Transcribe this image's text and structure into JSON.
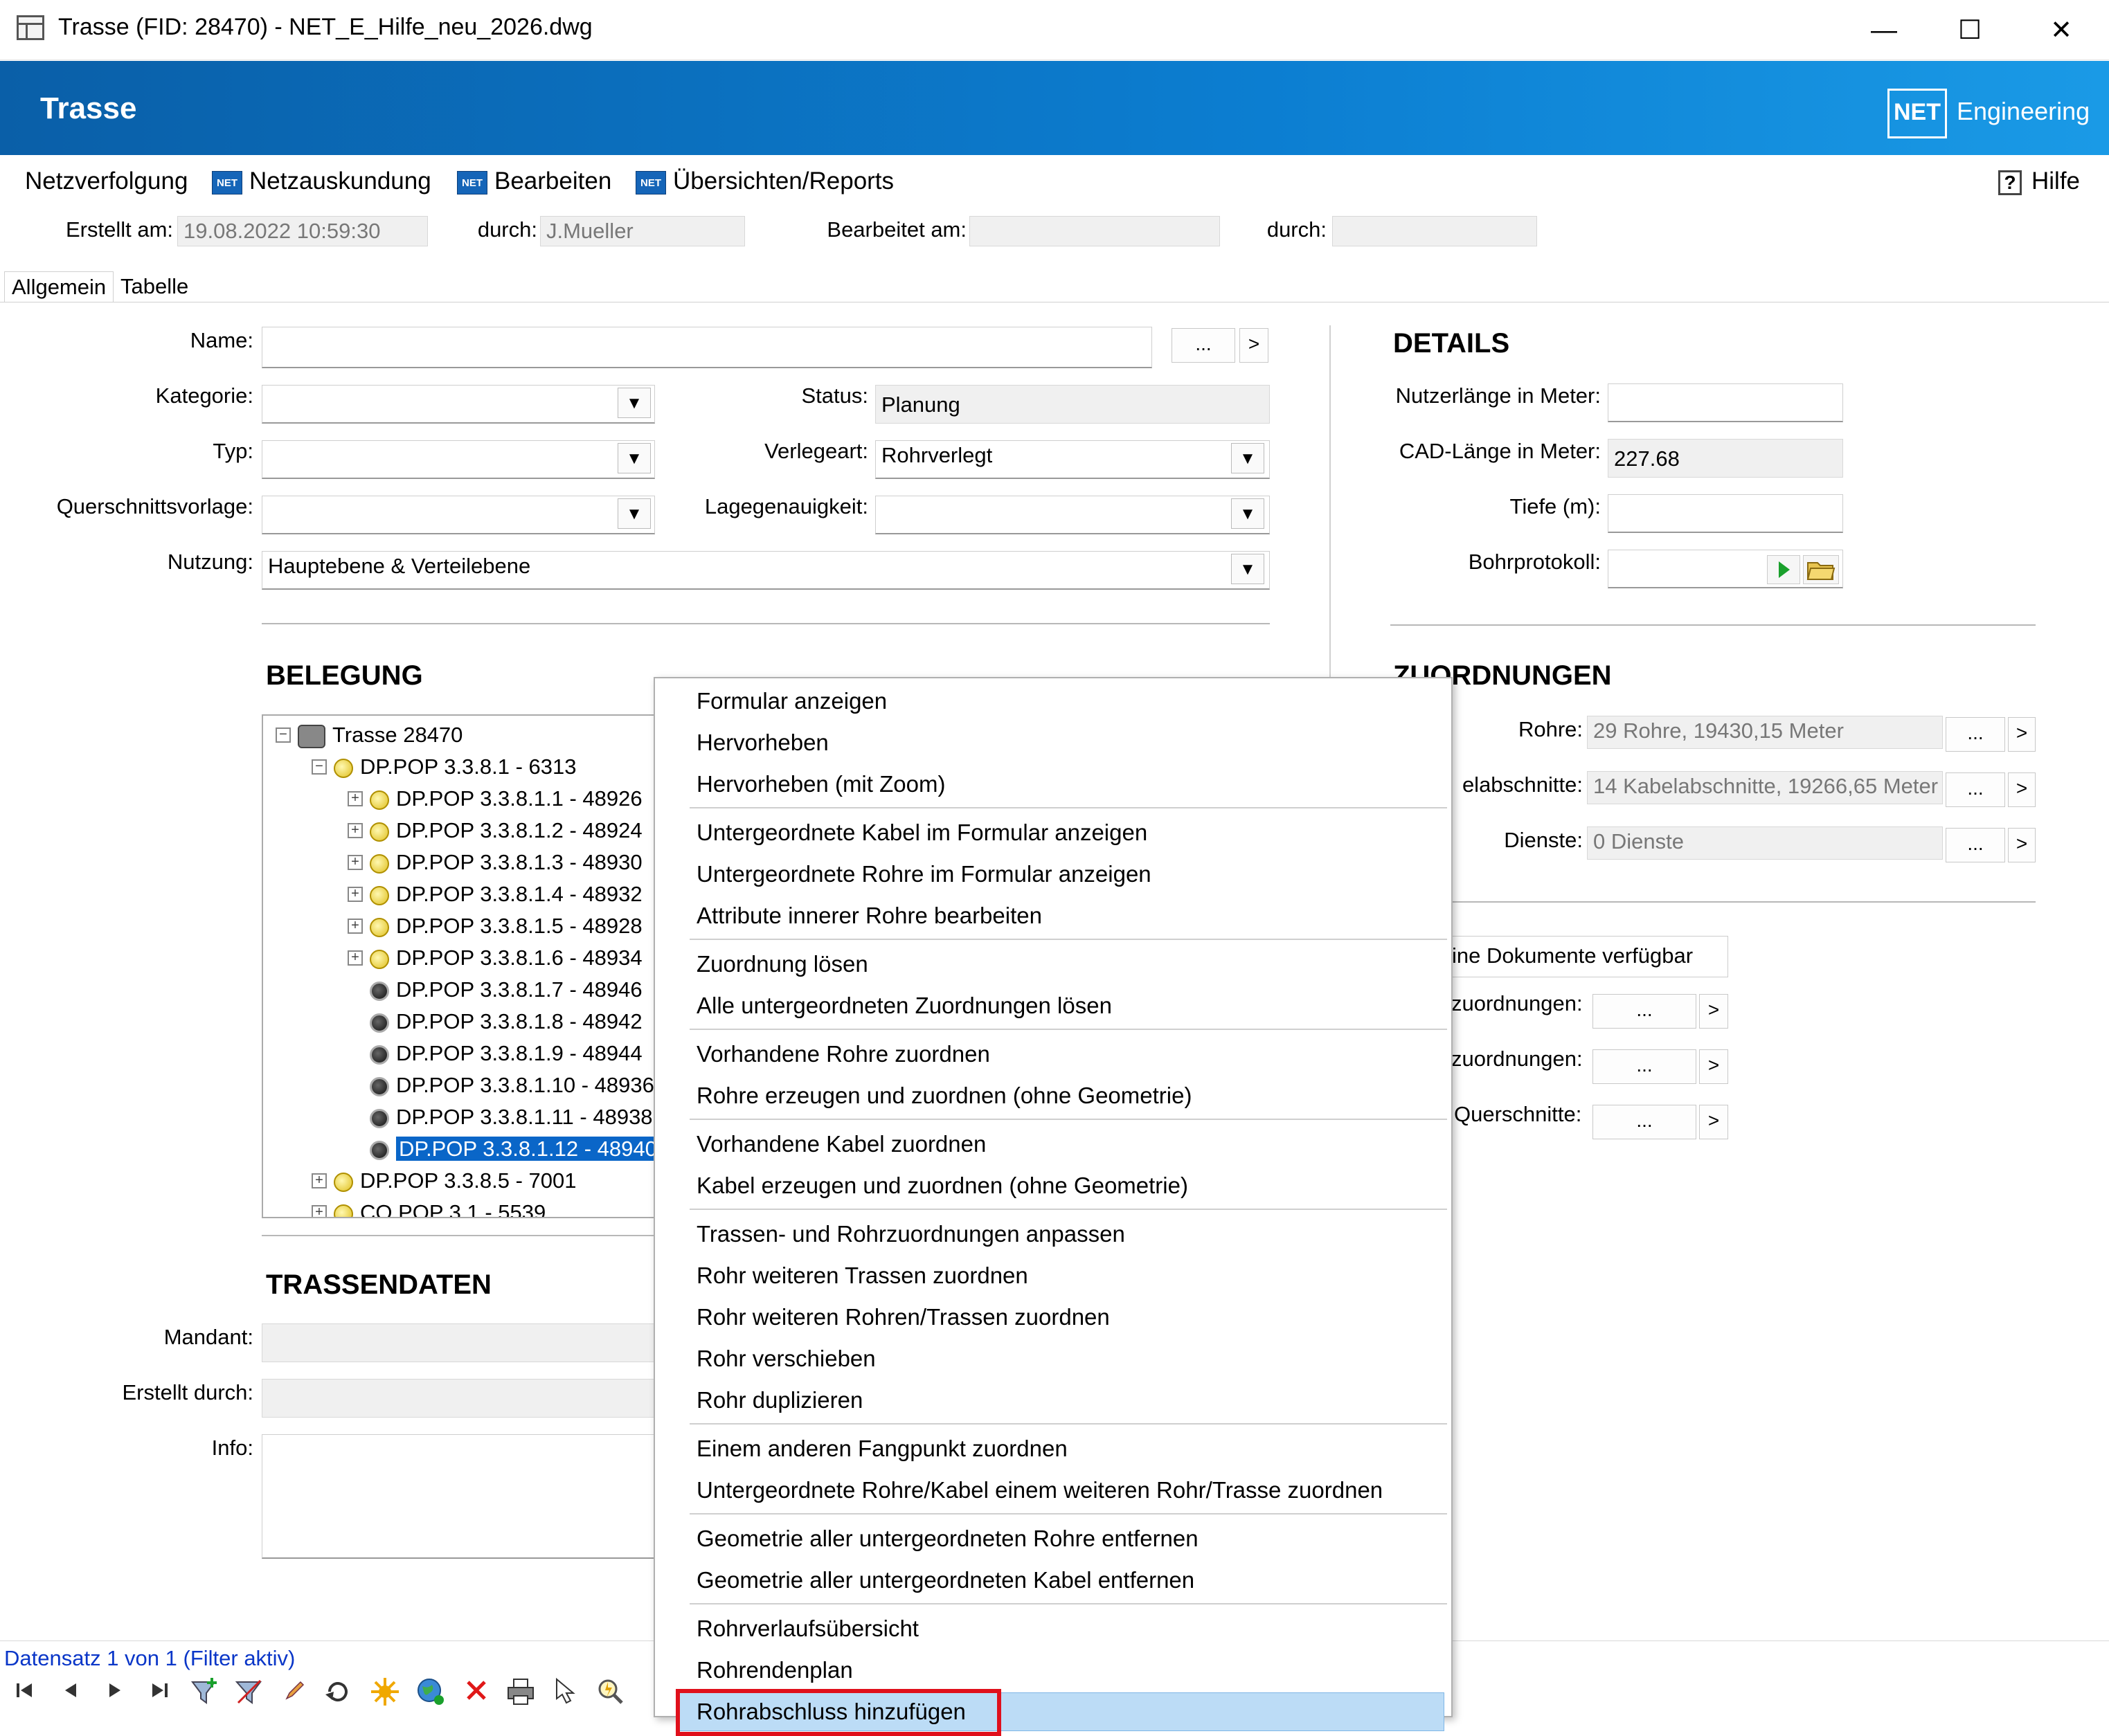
{
  "window": {
    "title": "Trasse (FID: 28470) - NET_E_Hilfe_neu_2026.dwg",
    "minimize": "—",
    "maximize": "☐",
    "close": "✕"
  },
  "banner": {
    "title": "Trasse",
    "logo": "NET",
    "brand": "Engineering"
  },
  "menu": {
    "items": [
      "Netzverfolgung",
      "Netzauskundung",
      "Bearbeiten",
      "Übersichten/Reports"
    ],
    "net_icon_text": "NET",
    "help": "Hilfe"
  },
  "meta": {
    "created_label": "Erstellt am:",
    "created_value": "19.08.2022 10:59:30",
    "by_label": "durch:",
    "by_value": "J.Mueller",
    "edited_label": "Bearbeitet am:",
    "edited_value": "",
    "by2_label": "durch:",
    "by2_value": ""
  },
  "tabs": [
    "Allgemein",
    "Tabelle"
  ],
  "form": {
    "name_label": "Name:",
    "name_value": "",
    "kategorie_label": "Kategorie:",
    "kategorie_value": "",
    "typ_label": "Typ:",
    "typ_value": "",
    "qsv_label": "Querschnittsvorlage:",
    "qsv_value": "",
    "nutzung_label": "Nutzung:",
    "nutzung_value": "Hauptebene & Verteilebene",
    "status_label": "Status:",
    "status_value": "Planung",
    "verlegeart_label": "Verlegeart:",
    "verlegeart_value": "Rohrverlegt",
    "lage_label": "Lagegenauigkeit:",
    "lage_value": "",
    "dots": "...",
    "arrow": ">",
    "dropdown": "▼"
  },
  "details": {
    "heading": "DETAILS",
    "nutzer_label": "Nutzerlänge in Meter:",
    "nutzer_value": "",
    "cad_label": "CAD-Länge in Meter:",
    "cad_value": "227.68",
    "tiefe_label": "Tiefe (m):",
    "tiefe_value": "",
    "bohr_label": "Bohrprotokoll:",
    "bohr_value": ""
  },
  "zuordnungen": {
    "heading": "ZUORDNUNGEN",
    "rohre_label": "Rohre:",
    "rohre_value": "29 Rohre, 19430,15 Meter",
    "kabel_label": "elabschnitte:",
    "kabel_value": "14 Kabelabschnitte, 19266,65 Meter",
    "dienste_label": "Dienste:",
    "dienste_value": "0 Dienste",
    "dokumente": "ine Dokumente verfügbar",
    "z1_label": "zuordnungen:",
    "z2_label": "zuordnungen:",
    "z3_label": "Querschnitte:"
  },
  "belegung": {
    "heading": "BELEGUNG",
    "tree": [
      {
        "label": "Trasse 28470",
        "level": 0,
        "icon": "root",
        "expand": "−"
      },
      {
        "label": "DP.POP 3.3.8.1 - 6313",
        "level": 1,
        "icon": "yellow",
        "expand": "−"
      },
      {
        "label": "DP.POP 3.3.8.1.1 - 48926",
        "level": 2,
        "icon": "yellow",
        "expand": "+"
      },
      {
        "label": "DP.POP 3.3.8.1.2 - 48924",
        "level": 2,
        "icon": "yellow",
        "expand": "+"
      },
      {
        "label": "DP.POP 3.3.8.1.3 - 48930",
        "level": 2,
        "icon": "yellow",
        "expand": "+"
      },
      {
        "label": "DP.POP 3.3.8.1.4 - 48932",
        "level": 2,
        "icon": "yellow",
        "expand": "+"
      },
      {
        "label": "DP.POP 3.3.8.1.5 - 48928",
        "level": 2,
        "icon": "yellow",
        "expand": "+"
      },
      {
        "label": "DP.POP 3.3.8.1.6 - 48934",
        "level": 2,
        "icon": "yellow",
        "expand": "+"
      },
      {
        "label": "DP.POP 3.3.8.1.7 - 48946",
        "level": 2,
        "icon": "black",
        "expand": ""
      },
      {
        "label": "DP.POP 3.3.8.1.8 - 48942",
        "level": 2,
        "icon": "black",
        "expand": ""
      },
      {
        "label": "DP.POP 3.3.8.1.9 - 48944",
        "level": 2,
        "icon": "black",
        "expand": ""
      },
      {
        "label": "DP.POP 3.3.8.1.10 - 48936",
        "level": 2,
        "icon": "black",
        "expand": ""
      },
      {
        "label": "DP.POP 3.3.8.1.11 - 48938",
        "level": 2,
        "icon": "black",
        "expand": ""
      },
      {
        "label": "DP.POP 3.3.8.1.12 - 48940",
        "level": 2,
        "icon": "black",
        "expand": "",
        "selected": true
      },
      {
        "label": "DP.POP 3.3.8.5 - 7001",
        "level": 1,
        "icon": "yellow",
        "expand": "+"
      },
      {
        "label": "CO.POP 3.1 - 5539",
        "level": 1,
        "icon": "yellow",
        "expand": "+"
      }
    ]
  },
  "trassendaten": {
    "heading": "TRASSENDATEN",
    "mandant_label": "Mandant:",
    "erstellt_label": "Erstellt durch:",
    "info_label": "Info:"
  },
  "context_menu": {
    "groups": [
      [
        "Formular anzeigen",
        "Hervorheben",
        "Hervorheben (mit Zoom)"
      ],
      [
        "Untergeordnete Kabel im Formular anzeigen",
        "Untergeordnete Rohre im Formular anzeigen",
        "Attribute innerer Rohre bearbeiten"
      ],
      [
        "Zuordnung lösen",
        "Alle untergeordneten Zuordnungen lösen"
      ],
      [
        "Vorhandene Rohre zuordnen",
        "Rohre erzeugen und zuordnen (ohne Geometrie)"
      ],
      [
        "Vorhandene Kabel zuordnen",
        "Kabel erzeugen und zuordnen (ohne Geometrie)"
      ],
      [
        "Trassen- und Rohrzuordnungen anpassen",
        "Rohr weiteren Trassen zuordnen",
        "Rohr weiteren Rohren/Trassen zuordnen",
        "Rohr verschieben",
        "Rohr duplizieren"
      ],
      [
        "Einem anderen Fangpunkt zuordnen",
        "Untergeordnete Rohre/Kabel einem weiteren Rohr/Trasse zuordnen"
      ],
      [
        "Geometrie aller untergeordneten Rohre entfernen",
        "Geometrie aller untergeordneten Kabel entfernen"
      ],
      [
        "Rohrverlaufsübersicht",
        "Rohrendenplan",
        "Rohrabschluss hinzufügen"
      ]
    ],
    "highlighted": "Rohrabschluss hinzufügen"
  },
  "statusbar": {
    "record": "Datensatz 1 von 1 (Filter aktiv)",
    "icons": [
      "first-record-icon",
      "prev-record-icon",
      "next-record-icon",
      "last-record-icon",
      "filter-add-icon",
      "filter-icon",
      "pencil-icon",
      "refresh-icon",
      "star-icon",
      "globe-icon",
      "delete-icon",
      "print-icon",
      "select-icon",
      "zoom-icon"
    ]
  },
  "colors": {
    "banner": "#0c7ed1",
    "selection": "#0a66c8",
    "highlight": "#bcdcf6",
    "red_frame": "#e0101c",
    "status_text": "#0a36c8"
  }
}
